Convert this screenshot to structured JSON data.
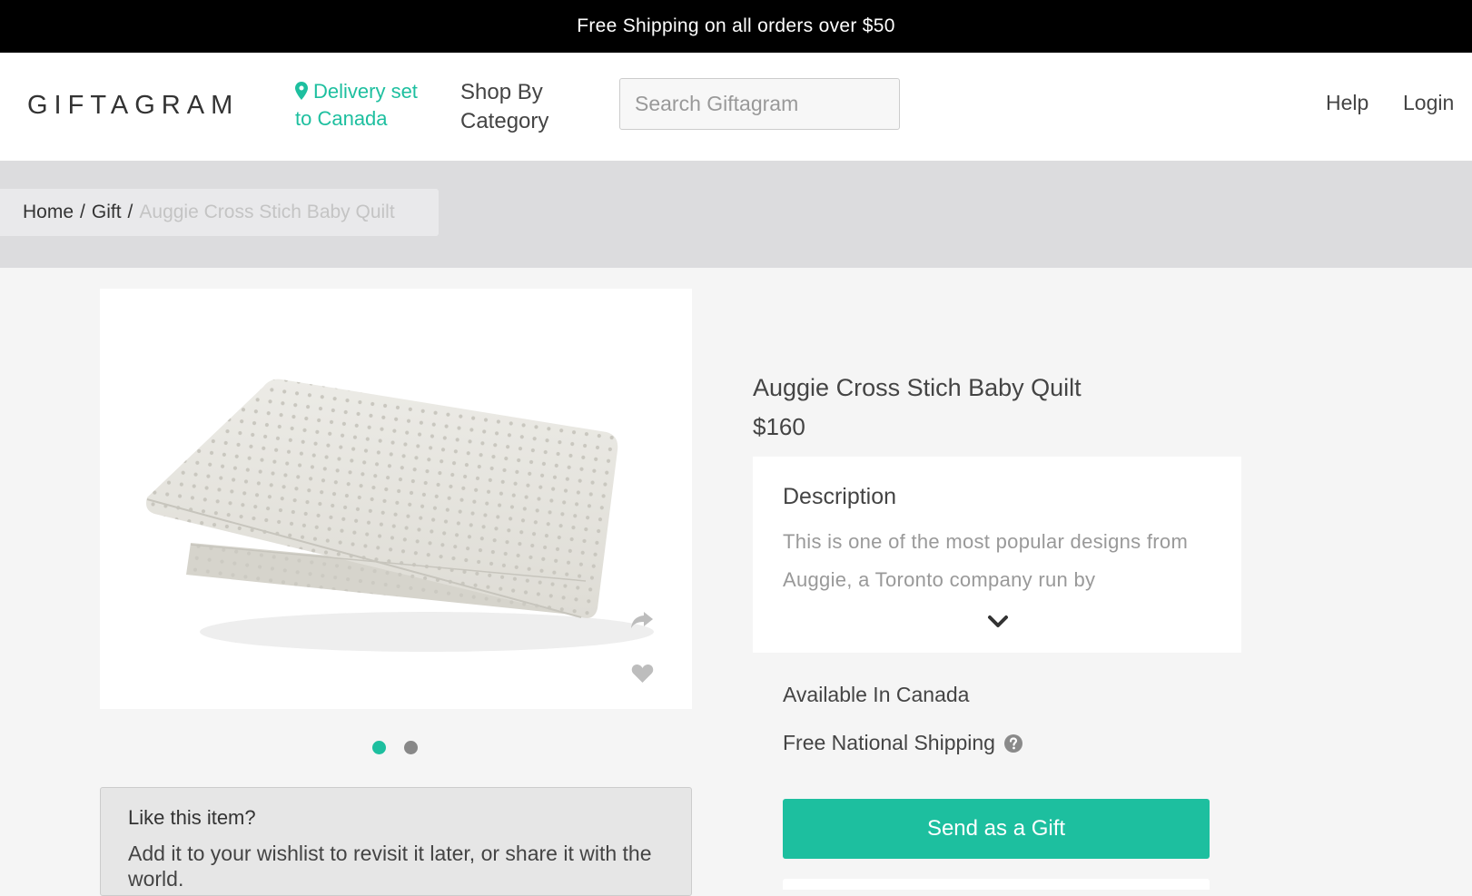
{
  "promo": {
    "text": "Free Shipping on all orders over $50"
  },
  "header": {
    "logo": "GIFTAGRAM",
    "delivery": "Delivery set to Canada",
    "shop_by": "Shop By Category",
    "search_placeholder": "Search Giftagram",
    "help": "Help",
    "login": "Login"
  },
  "breadcrumb": {
    "items": [
      "Home",
      "Gift"
    ],
    "separator": "/",
    "current": "Auggie Cross Stich Baby Quilt"
  },
  "product": {
    "title": "Auggie Cross Stich Baby Quilt",
    "price": "$160",
    "description_heading": "Description",
    "description_text": "This is one of the most popular designs from Auggie, a Toronto company run by",
    "availability": "Available In Canada",
    "shipping": "Free National Shipping",
    "cta": "Send as a Gift"
  },
  "carousel": {
    "count": 2,
    "active_index": 0
  },
  "wishlist": {
    "title": "Like this item?",
    "text": "Add it to your wishlist to revisit it later, or share it with the world."
  },
  "colors": {
    "accent": "#1dbf9f",
    "promo_bg": "#000000"
  },
  "icons": [
    "map-pin-icon",
    "search-icon",
    "share-icon",
    "heart-icon",
    "chevron-down-icon",
    "help-icon"
  ]
}
